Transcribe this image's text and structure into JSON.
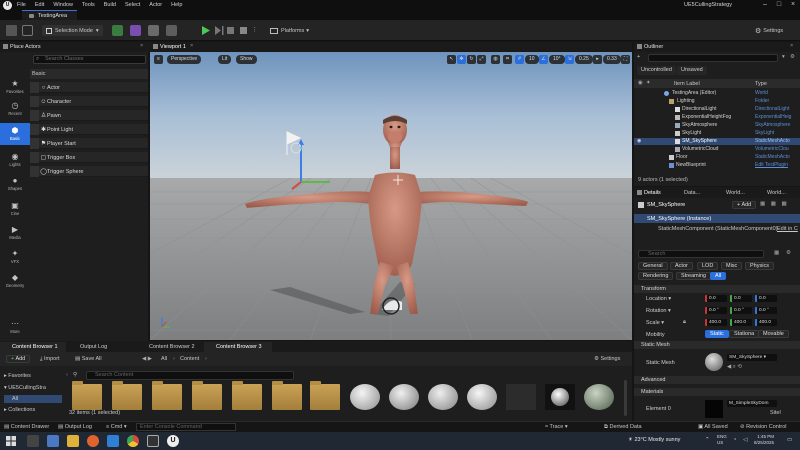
{
  "menubar": {
    "logo": "U",
    "items": [
      "File",
      "Edit",
      "Window",
      "Tools",
      "Build",
      "Select",
      "Actor",
      "Help"
    ],
    "project_name": "UE5CullingStrategy"
  },
  "level_tab": {
    "label": "TestingArea"
  },
  "toolbar": {
    "mode_label": "Selection Mode",
    "platforms_label": "Platforms",
    "settings_label": "Settings"
  },
  "left_strip": [
    {
      "label": "Favorites",
      "icon": "star-icon"
    },
    {
      "label": "Recent",
      "icon": "clock-icon"
    },
    {
      "label": "Basic",
      "icon": "cubes-icon",
      "active": true
    },
    {
      "label": "Lights",
      "icon": "bulb-icon"
    },
    {
      "label": "Shapes",
      "icon": "shapes-icon"
    },
    {
      "label": "Cine",
      "icon": "camera-icon"
    },
    {
      "label": "Media",
      "icon": "media-icon"
    },
    {
      "label": "VFX",
      "icon": "vfx-icon"
    },
    {
      "label": "Geometry",
      "icon": "geometry-icon"
    },
    {
      "label": "More",
      "icon": "more-icon"
    }
  ],
  "place_actors": {
    "tab_label": "Place Actors",
    "search_placeholder": "Search Classes",
    "section": "Basic",
    "items": [
      "Actor",
      "Character",
      "Pawn",
      "Point Light",
      "Player Start",
      "Trigger Box",
      "Trigger Sphere"
    ]
  },
  "viewport": {
    "tab_label": "Viewport 1",
    "perspective": "Perspective",
    "lit": "Lit",
    "show": "Show",
    "grid_snap": "10",
    "rot_snap": "10°",
    "scale_snap": "0.25",
    "cam_speed": "0.33"
  },
  "outliner": {
    "tab_label": "Outliner",
    "tabs": [
      "Uncontrolled",
      "Unsaved"
    ],
    "col_label": "Item Label",
    "col_type": "Type",
    "rows": [
      {
        "label": "TestingArea (Editor)",
        "type": "World",
        "indent": 0
      },
      {
        "label": "Lighting",
        "type": "Folder",
        "indent": 1
      },
      {
        "label": "DirectionalLight",
        "type": "DirectionalLight",
        "indent": 2
      },
      {
        "label": "ExponentialHeightFog",
        "type": "ExponentialHeig",
        "indent": 2
      },
      {
        "label": "SkyAtmosphere",
        "type": "SkyAtmosphere",
        "indent": 2
      },
      {
        "label": "SkyLight",
        "type": "SkyLight",
        "indent": 2
      },
      {
        "label": "SM_SkySphere",
        "type": "StaticMeshActo",
        "indent": 2,
        "selected": true
      },
      {
        "label": "VolumetricCloud",
        "type": "VolumetricClou",
        "indent": 2
      },
      {
        "label": "Floor",
        "type": "StaticMeshActo",
        "indent": 1
      },
      {
        "label": "NewBlueprint",
        "type": "Edit TestPlugin",
        "indent": 1
      }
    ],
    "count": "9 actors (1 selected)"
  },
  "details": {
    "tabs": [
      "Details",
      "Data...",
      "World...",
      "World..."
    ],
    "actor_name": "SM_SkySphere",
    "add_label": "Add",
    "instance": "SM_SkySphere (Instance)",
    "component": "StaticMeshComponent (StaticMeshComponent0)",
    "component_edit": "Edit in C",
    "search_placeholder": "Search",
    "filter_row1": [
      "General",
      "Actor",
      "LOD",
      "Misc",
      "Physics"
    ],
    "filter_row2": [
      "Rendering",
      "Streaming",
      "All"
    ],
    "transform_header": "Transform",
    "location_label": "Location",
    "rotation_label": "Rotation",
    "scale_label": "Scale",
    "location": [
      "0.0",
      "0.0",
      "0.0"
    ],
    "rotation": [
      "0.0 °",
      "0.0 °",
      "0.0 °"
    ],
    "scale": [
      "400.0",
      "400.0",
      "400.0"
    ],
    "mobility_label": "Mobility",
    "mobility": [
      "Static",
      "Stationa",
      "Movable"
    ],
    "static_mesh_header": "Static Mesh",
    "static_mesh_label": "Static Mesh",
    "static_mesh_value": "SM_SkySphere",
    "advanced_header": "Advanced",
    "materials_header": "Materials",
    "element_label": "Element 0",
    "element_value": "M_SimpleSkyDom",
    "element_sub": "Sitel"
  },
  "content_browser": {
    "tabs": [
      "Content Browser 1",
      "Output Log",
      "Content Browser 2",
      "Content Browser 3"
    ],
    "add_label": "Add",
    "import_label": "Import",
    "save_all_label": "Save All",
    "path": [
      "All",
      "Content"
    ],
    "settings_label": "Settings",
    "favorites": "Favorites",
    "project_folder": "UE5CullingStra",
    "all_item": "All",
    "collections": "Collections",
    "search_placeholder": "Search Content",
    "count": "32 items (1 selected)"
  },
  "statusbar": {
    "content_drawer": "Content Drawer",
    "output_log": "Output Log",
    "cmd": "Cmd",
    "console_placeholder": "Enter Console Command",
    "trace": "Trace",
    "derived_data": "Derived Data",
    "all_saved": "All Saved",
    "revision_control": "Revision Control"
  },
  "taskbar": {
    "weather": "23°C  Mostly sunny",
    "lang": "ENG",
    "region": "US",
    "time": "1:45 PM",
    "date": "8/25/2025"
  },
  "colors": {
    "accent": "#2a6fdb",
    "folder": "#c9a256",
    "select_row": "#304a74"
  }
}
